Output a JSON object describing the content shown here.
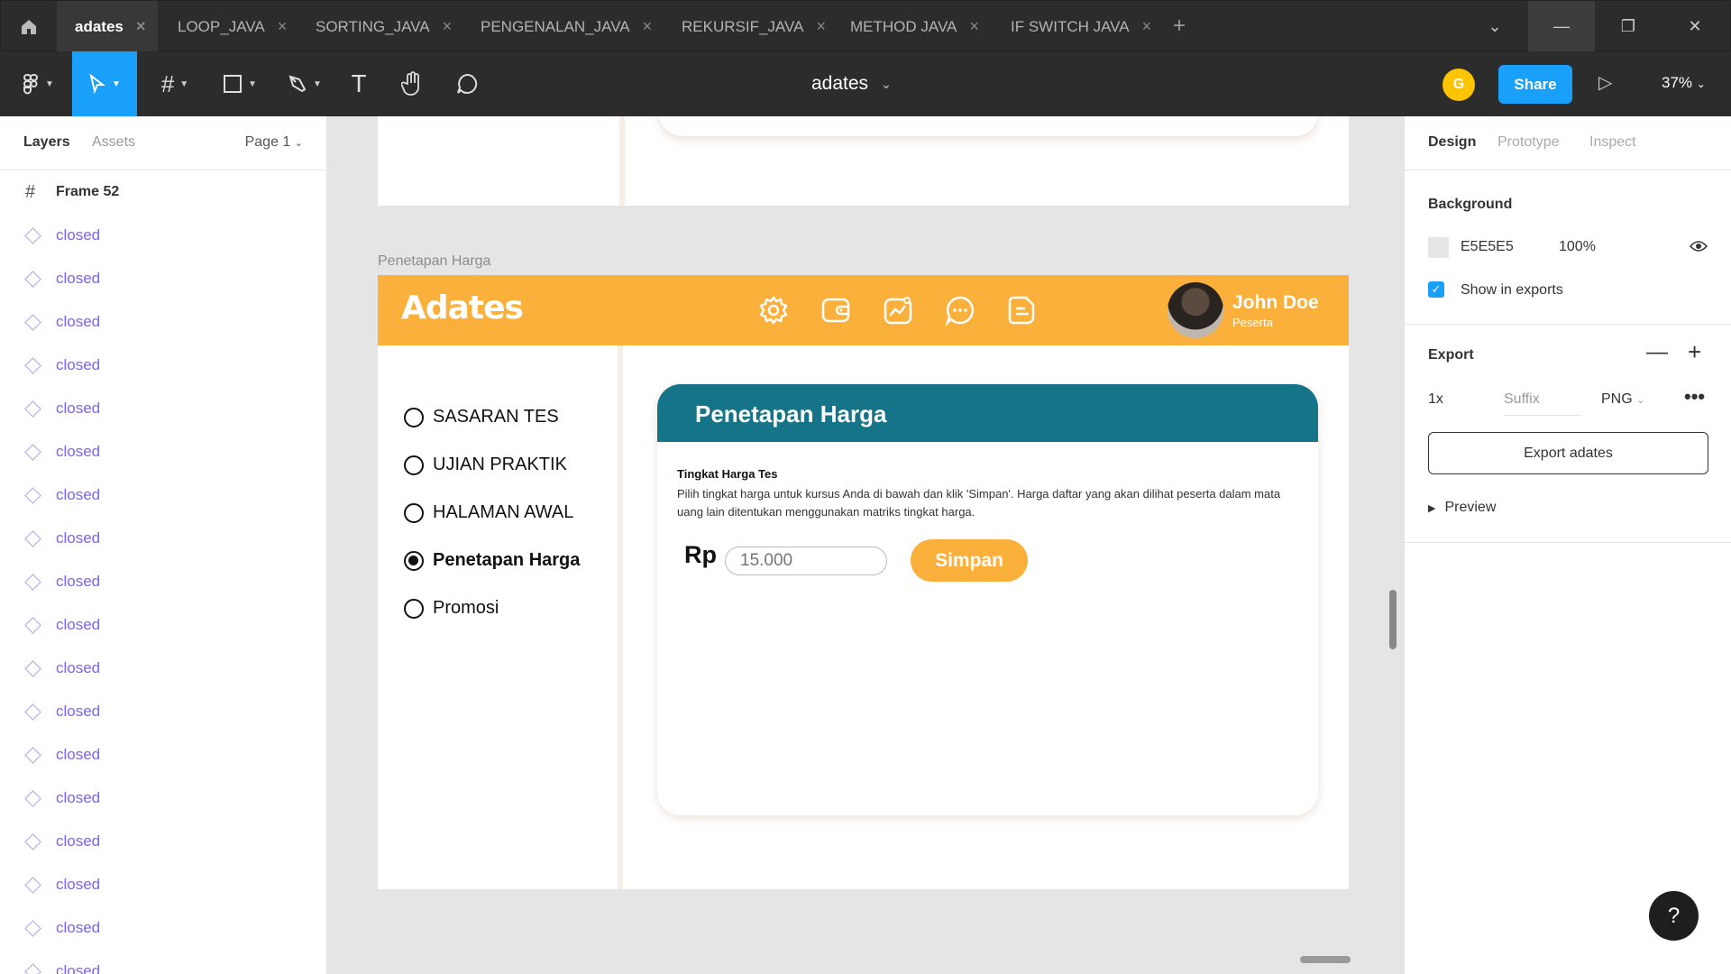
{
  "tabs": [
    {
      "label": "adates",
      "active": true
    },
    {
      "label": "LOOP_JAVA"
    },
    {
      "label": "SORTING_JAVA"
    },
    {
      "label": "PENGENALAN_JAVA"
    },
    {
      "label": "REKURSIF_JAVA"
    },
    {
      "label": "METHOD JAVA"
    },
    {
      "label": "IF SWITCH JAVA"
    }
  ],
  "toolbar": {
    "doc_title": "adates",
    "user_initial": "G",
    "share_label": "Share",
    "zoom": "37%"
  },
  "left_panel": {
    "tab_layers": "Layers",
    "tab_assets": "Assets",
    "page": "Page 1",
    "frame_name": "Frame 52",
    "layers": [
      "closed",
      "closed",
      "closed",
      "closed",
      "closed",
      "closed",
      "closed",
      "closed",
      "closed",
      "closed",
      "closed",
      "closed",
      "closed",
      "closed",
      "closed",
      "closed",
      "closed",
      "closed"
    ]
  },
  "right_panel": {
    "tab_design": "Design",
    "tab_prototype": "Prototype",
    "tab_inspect": "Inspect",
    "background_title": "Background",
    "bg_hex": "E5E5E5",
    "bg_opacity": "100%",
    "show_in_exports": "Show in exports",
    "export_title": "Export",
    "scale": "1x",
    "suffix_placeholder": "Suffix",
    "format": "PNG",
    "export_button": "Export adates",
    "preview": "Preview",
    "help": "?"
  },
  "canvas": {
    "frame_label": "Penetapan Harga",
    "app": {
      "logo": "Adates",
      "user_name": "John Doe",
      "user_role": "Peserta",
      "menu": [
        {
          "label": "SASARAN TES",
          "selected": false
        },
        {
          "label": "UJIAN PRAKTIK",
          "selected": false
        },
        {
          "label": "HALAMAN AWAL",
          "selected": false
        },
        {
          "label": "Penetapan Harga",
          "selected": true
        },
        {
          "label": "Promosi",
          "selected": false
        }
      ],
      "card_title": "Penetapan Harga",
      "subtitle": "Tingkat Harga Tes",
      "description": "Pilih tingkat harga untuk kursus Anda di bawah dan klik 'Simpan'. Harga daftar yang akan dilihat peserta dalam mata uang lain ditentukan menggunakan matriks tingkat harga.",
      "currency": "Rp",
      "price_placeholder": "15.000",
      "save_label": "Simpan"
    }
  },
  "colors": {
    "accent": "#18a0fb",
    "app_header": "#fbb03b",
    "card_header": "#167488"
  }
}
